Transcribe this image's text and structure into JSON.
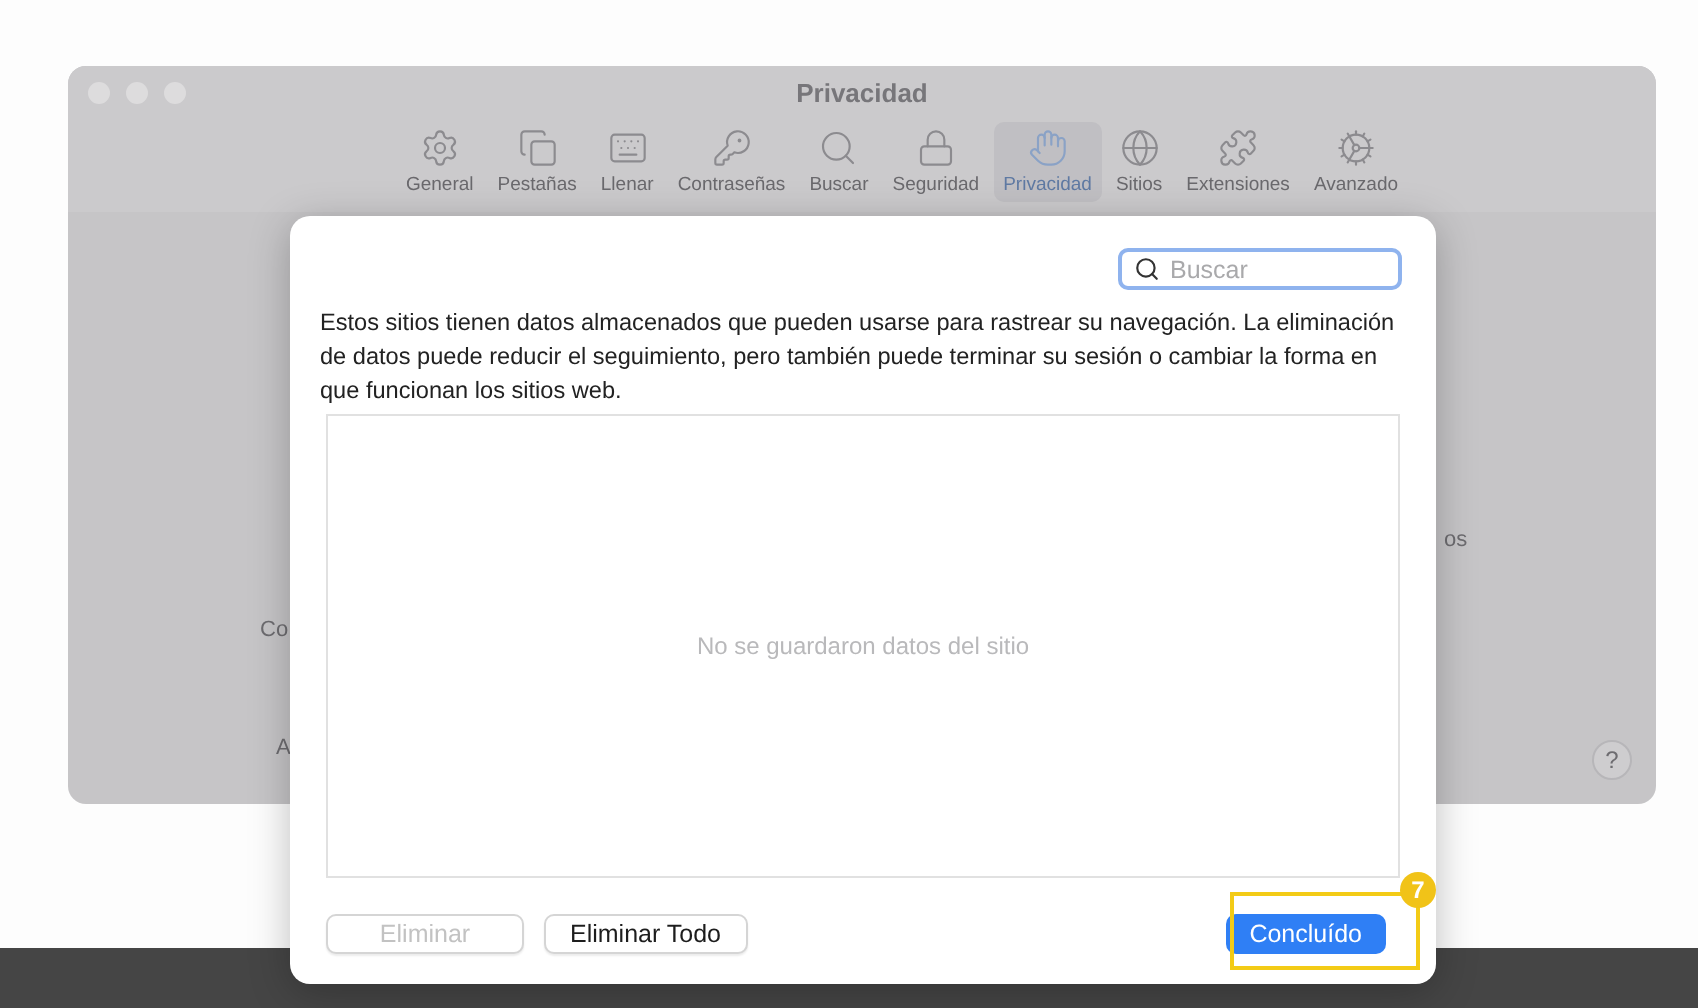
{
  "window": {
    "title": "Privacidad"
  },
  "toolbar": [
    {
      "label": "General",
      "selected": false
    },
    {
      "label": "Pestañas",
      "selected": false
    },
    {
      "label": "Llenar",
      "selected": false
    },
    {
      "label": "Contraseñas",
      "selected": false
    },
    {
      "label": "Buscar",
      "selected": false
    },
    {
      "label": "Seguridad",
      "selected": false
    },
    {
      "label": "Privacidad",
      "selected": true
    },
    {
      "label": "Sitios",
      "selected": false
    },
    {
      "label": "Extensiones",
      "selected": false
    },
    {
      "label": "Avanzado",
      "selected": false
    }
  ],
  "background_fragments": [
    "Co",
    "A",
    "os"
  ],
  "help_button": "?",
  "dialog": {
    "search": {
      "placeholder": "Buscar"
    },
    "description": "Estos sitios tienen datos almacenados que pueden usarse para rastrear su navegación. La eliminación de datos puede reducir el seguimiento, pero también puede terminar su sesión o cambiar la forma en que funcionan los sitios web.",
    "empty_message": "No se guardaron datos del sitio",
    "buttons": [
      {
        "label": "Eliminar",
        "kind": "secondary",
        "disabled": true
      },
      {
        "label": "Eliminar Todo",
        "kind": "secondary",
        "disabled": false
      },
      {
        "label": "Concluído",
        "kind": "primary",
        "disabled": false
      }
    ]
  },
  "annotation": {
    "badge": "7"
  }
}
